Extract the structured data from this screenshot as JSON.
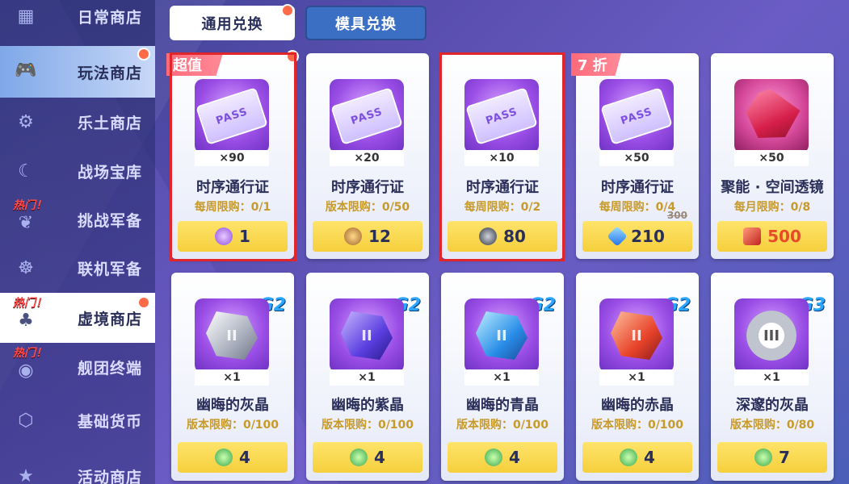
{
  "sidebar": {
    "items": [
      {
        "label": "日常商店",
        "icon": "grid-icon",
        "hot": ""
      },
      {
        "label": "玩法商店",
        "icon": "gamepad-icon",
        "hot": ""
      },
      {
        "label": "乐土商店",
        "icon": "gear-icon",
        "hot": ""
      },
      {
        "label": "战场宝库",
        "icon": "moon-icon",
        "hot": ""
      },
      {
        "label": "挑战军备",
        "icon": "emblem-icon",
        "hot": "热门！"
      },
      {
        "label": "联机军备",
        "icon": "group-icon",
        "hot": ""
      },
      {
        "label": "虚境商店",
        "icon": "plant-icon",
        "hot": "热门！"
      },
      {
        "label": "舰团终端",
        "icon": "eye-icon",
        "hot": "热门！"
      },
      {
        "label": "基础货币",
        "icon": "hex-icon",
        "hot": ""
      },
      {
        "label": "活动商店",
        "icon": "star-icon",
        "hot": ""
      }
    ]
  },
  "tabs": {
    "general": "通用兑换",
    "mold": "模具兑换"
  },
  "items": [
    {
      "name": "时序通行证",
      "qty": "×90",
      "limit": "每周限购：0/1",
      "price": "1",
      "currency": "purple-gem-icon",
      "ribbon": "超值",
      "icon_text": "PASS"
    },
    {
      "name": "时序通行证",
      "qty": "×20",
      "limit": "版本限购：0/50",
      "price": "12",
      "currency": "bronze-badge-icon",
      "ribbon": "",
      "icon_text": "PASS"
    },
    {
      "name": "时序通行证",
      "qty": "×10",
      "limit": "每周限购：0/2",
      "price": "80",
      "currency": "dark-token-icon",
      "ribbon": "",
      "icon_text": "PASS"
    },
    {
      "name": "时序通行证",
      "qty": "×50",
      "limit": "每周限购：0/4",
      "price": "210",
      "old_price": "300",
      "currency": "blue-crystal-icon",
      "ribbon": "7 折",
      "icon_text": "PASS"
    },
    {
      "name": "聚能 · 空间透镜",
      "qty": "×50",
      "limit": "每月限购：0/8",
      "price": "500",
      "currency": "red-chip-icon",
      "ribbon": "",
      "icon_text": ""
    },
    {
      "name": "幽晦的灰晶",
      "qty": "×1",
      "limit": "版本限购：0/100",
      "price": "4",
      "currency": "green-skull-icon",
      "grade": "G2",
      "icon_text": "II"
    },
    {
      "name": "幽晦的紫晶",
      "qty": "×1",
      "limit": "版本限购：0/100",
      "price": "4",
      "currency": "green-skull-icon",
      "grade": "G2",
      "icon_text": "II"
    },
    {
      "name": "幽晦的青晶",
      "qty": "×1",
      "limit": "版本限购：0/100",
      "price": "4",
      "currency": "green-skull-icon",
      "grade": "G2",
      "icon_text": "II"
    },
    {
      "name": "幽晦的赤晶",
      "qty": "×1",
      "limit": "版本限购：0/100",
      "price": "4",
      "currency": "green-skull-icon",
      "grade": "G2",
      "icon_text": "II"
    },
    {
      "name": "深邃的灰晶",
      "qty": "×1",
      "limit": "版本限购：0/80",
      "price": "7",
      "currency": "green-skull-icon",
      "grade": "G3",
      "icon_text": "III"
    }
  ],
  "colors": {
    "accent_yellow": "#f5cf3c",
    "limit_gold": "#c79a2a",
    "highlight_red": "#e0252b",
    "ribbon_pink": "#ff6a7a",
    "grade_blue": "#2aa6ff"
  }
}
